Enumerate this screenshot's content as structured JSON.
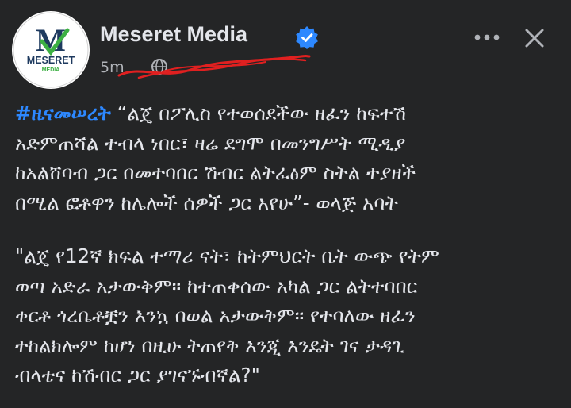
{
  "post": {
    "page_name": "Meseret Media",
    "timestamp": "5m",
    "logo": {
      "brand": "MESERET",
      "tagline": "MEDIA",
      "letter": "M"
    },
    "verified_icon": "verified-badge-icon",
    "audience_icon": "globe-icon",
    "more_icon": "more-options-icon",
    "close_icon": "close-icon",
    "hashtag": "#ዜናመሠረት",
    "paragraph1": " “ልጄ በፖሊስ የተወሰደችው ዘፈን ከፍተሽ\nአድምጠሻል ተብላ ነበር፣ ዛሬ ደግሞ በመንግሥት ሚዲያ\nከአልሸባብ ጋር በመተባበር ሽብር ልትፈፅም ስትል ተያዘች\nበሚል ፎቶዋን ከሌሎች ሰዎች ጋር አየሁ”- ወላጅ አባት",
    "paragraph2": "\"ልጄ የ12ኛ ክፍል ተማሪ ናት፣ ከትምህርት ቤት ውጭ የትም\nወጣ አድራ አታውቅም። ከተጠቀሰው አካል ጋር ልትተባበር\nቀርቶ ጎረቤቶቿን እንኳ በወል አታውቅም። የተባለው ዘፈን\nተከልክሎም ከሆነ በዚሁ ትጠየቅ እንጂ እንዴት ገና ታዳጊ\nብላቴና ከሽብር ጋር ያገናኙብኛል?\""
  },
  "colors": {
    "background": "#242526",
    "text": "#e4e6eb",
    "secondary_text": "#b0b3b8",
    "hashtag": "#2d88ff",
    "verified": "#2d88ff",
    "brand_navy": "#1e3a5f",
    "brand_green": "#3cb043",
    "scribble": "#e02020"
  }
}
